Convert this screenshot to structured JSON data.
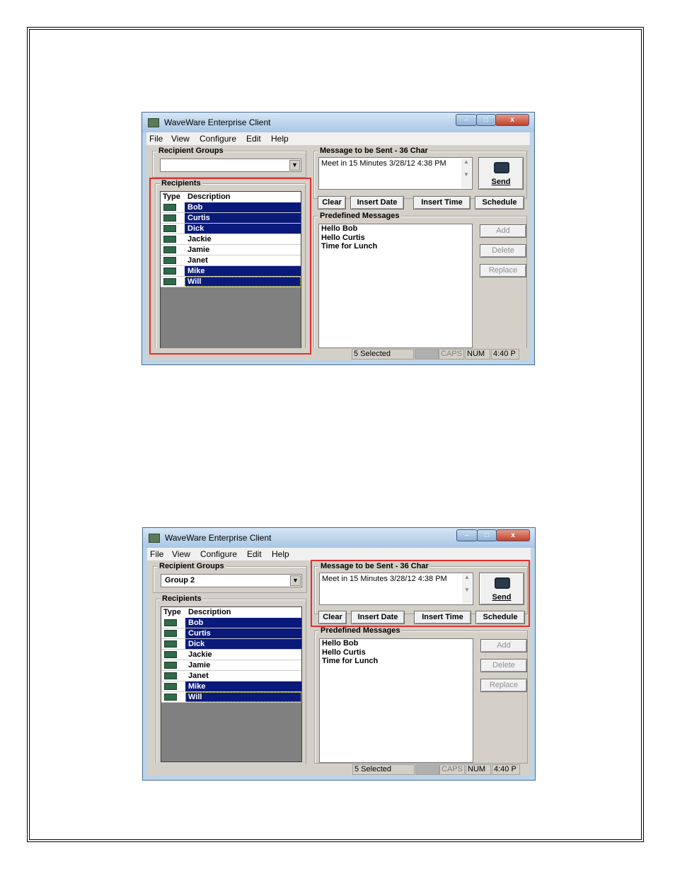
{
  "window": {
    "title": "WaveWare Enterprise Client",
    "min_glyph": "–",
    "max_glyph": "□",
    "close_glyph": "x"
  },
  "menu": [
    "File",
    "View",
    "Configure",
    "Edit",
    "Help"
  ],
  "labels": {
    "recipient_groups": "Recipient Groups",
    "recipients": "Recipients",
    "message_to_be_sent": "Message to be Sent - 36 Char",
    "predefined_messages": "Predefined Messages",
    "col_type": "Type",
    "col_description": "Description"
  },
  "message_text": "Meet in 15 Minutes  3/28/12  4:38 PM",
  "buttons": {
    "send": "Send",
    "clear": "Clear",
    "insert_date": "Insert Date",
    "insert_time": "Insert Time",
    "schedule": "Schedule",
    "add": "Add",
    "delete": "Delete",
    "replace": "Replace"
  },
  "recipients": [
    {
      "name": "Bob",
      "selected": true
    },
    {
      "name": "Curtis",
      "selected": true
    },
    {
      "name": "Dick",
      "selected": true
    },
    {
      "name": "Jackie",
      "selected": false
    },
    {
      "name": "Jamie",
      "selected": false
    },
    {
      "name": "Janet",
      "selected": false
    },
    {
      "name": "Mike",
      "selected": true
    },
    {
      "name": "Will",
      "selected": true
    }
  ],
  "predefined_messages": [
    "Hello Bob",
    "Hello Curtis",
    "Time for Lunch"
  ],
  "status": {
    "selected": "5 Selected",
    "caps": "CAPS",
    "num": "NUM",
    "time": "4:40 P"
  },
  "screenshots": [
    {
      "group_value": "",
      "highlight": "recipients"
    },
    {
      "group_value": "Group 2",
      "highlight": "message"
    }
  ],
  "colors": {
    "selection": "#0a1a7a",
    "highlight_box": "#e03030",
    "dialog_face": "#d4d0c8"
  }
}
